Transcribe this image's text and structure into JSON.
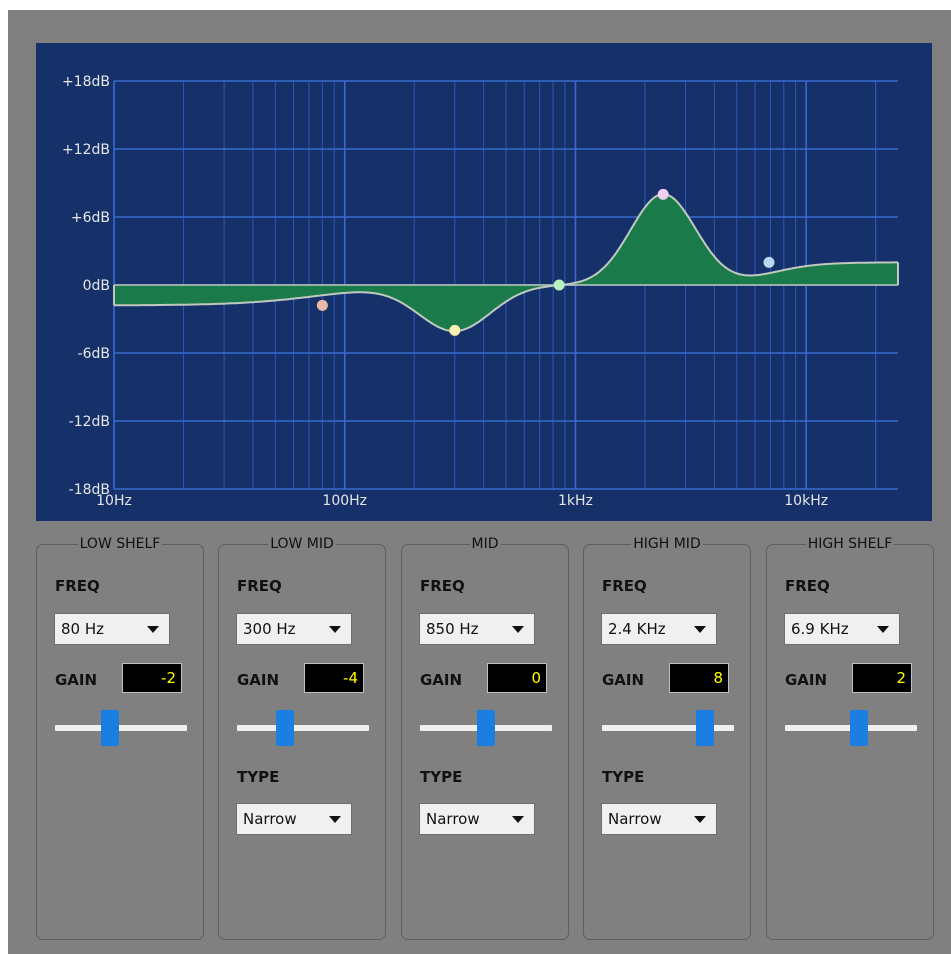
{
  "graph": {
    "y_ticks": [
      "+18dB",
      "+12dB",
      "+6dB",
      "0dB",
      "-6dB",
      "-12dB",
      "-18dB"
    ],
    "x_ticks": [
      "10Hz",
      "100Hz",
      "1kHz",
      "10kHz"
    ],
    "curve_fill": "#1b7a4a",
    "curve_line": "#c0c8c0",
    "bands": [
      {
        "freq_hz": 80,
        "gain_db": -1.8,
        "dot_color": "#e8b8a8"
      },
      {
        "freq_hz": 300,
        "gain_db": -4,
        "dot_color": "#f8f0b0"
      },
      {
        "freq_hz": 850,
        "gain_db": 0,
        "dot_color": "#b8f0c0"
      },
      {
        "freq_hz": 2400,
        "gain_db": 8,
        "dot_color": "#f0d0f0"
      },
      {
        "freq_hz": 6900,
        "gain_db": 2,
        "dot_color": "#b8d8f0"
      }
    ]
  },
  "labels": {
    "freq": "FREQ",
    "gain": "GAIN",
    "type": "TYPE"
  },
  "bands": [
    {
      "title": "LOW SHELF",
      "freq": "80 Hz",
      "gain": "-2",
      "slider_fraction": 0.42
    },
    {
      "title": "LOW MID",
      "freq": "300 Hz",
      "gain": "-4",
      "slider_fraction": 0.36,
      "type": "Narrow"
    },
    {
      "title": "MID",
      "freq": "850 Hz",
      "gain": "0",
      "slider_fraction": 0.5,
      "type": "Narrow"
    },
    {
      "title": "HIGH MID",
      "freq": "2.4 KHz",
      "gain": "8",
      "slider_fraction": 0.78,
      "type": "Narrow"
    },
    {
      "title": "HIGH SHELF",
      "freq": "6.9 KHz",
      "gain": "2",
      "slider_fraction": 0.56
    }
  ]
}
